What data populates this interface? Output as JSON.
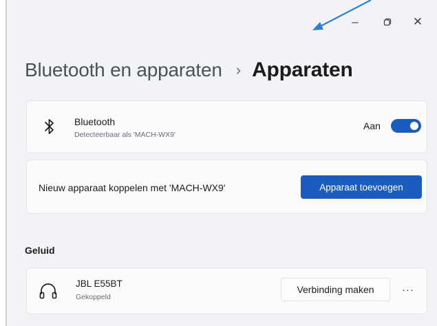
{
  "window": {
    "minimize_glyph": "–",
    "maximize_glyph": "▢",
    "close_glyph": "✕"
  },
  "breadcrumb": {
    "parent": "Bluetooth en apparaten",
    "separator": "›",
    "current": "Apparaten"
  },
  "bluetooth_card": {
    "icon": "bluetooth-icon",
    "title": "Bluetooth",
    "subtitle": "Detecteerbaar als 'MACH-WX9'",
    "toggle_label": "Aan",
    "toggle_on": true
  },
  "pair_card": {
    "label": "Nieuw apparaat koppelen met 'MACH-WX9'",
    "button": "Apparaat toevoegen"
  },
  "section": {
    "label": "Geluid"
  },
  "devices": [
    {
      "icon": "headphones-icon",
      "name": "JBL E55BT",
      "status": "Gekoppeld",
      "button": "Verbinding maken",
      "more": "···"
    }
  ],
  "colors": {
    "accent": "#1a5dbf",
    "annotation_arrow": "#2f7fd0",
    "background": "#f1f3f6",
    "card": "#fbfbfc"
  }
}
